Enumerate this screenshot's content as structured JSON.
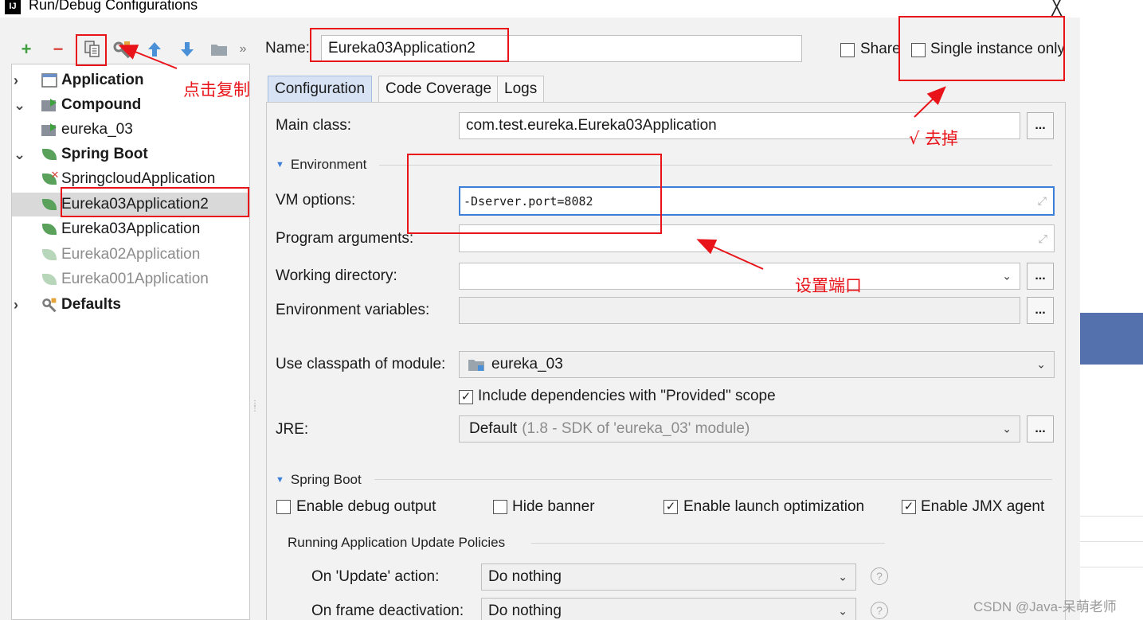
{
  "window": {
    "title": "Run/Debug Configurations",
    "app_icon_text": "IJ",
    "close_glyph": "╳"
  },
  "toolbar": {
    "add": "+",
    "remove": "−",
    "more": "»"
  },
  "tree": {
    "items": [
      {
        "label": "Application",
        "arrow": "›",
        "icon": "application-icon",
        "bold": true
      },
      {
        "label": "Compound",
        "arrow": "⌄",
        "icon": "compound-icon",
        "bold": true
      },
      {
        "label": "eureka_03",
        "icon": "compound-item-icon"
      },
      {
        "label": "Spring Boot",
        "arrow": "⌄",
        "icon": "spring-boot-icon",
        "bold": true
      },
      {
        "label": "SpringcloudApplication",
        "icon": "spring-boot-error-icon"
      },
      {
        "label": "Eureka03Application2",
        "icon": "spring-boot-run-icon",
        "selected": true
      },
      {
        "label": "Eureka03Application",
        "icon": "spring-boot-run-icon"
      },
      {
        "label": "Eureka02Application",
        "icon": "spring-boot-run-icon",
        "dimmed": true
      },
      {
        "label": "Eureka001Application",
        "icon": "spring-boot-run-icon",
        "dimmed": true
      },
      {
        "label": "Defaults",
        "arrow": "›",
        "icon": "defaults-icon",
        "bold": true
      }
    ]
  },
  "header": {
    "name_label": "Name:",
    "name_value": "Eureka03Application2",
    "share_label": "Share",
    "single_instance_label": "Single instance only"
  },
  "tabs": [
    {
      "label": "Configuration",
      "active": true
    },
    {
      "label": "Code Coverage"
    },
    {
      "label": "Logs"
    }
  ],
  "form": {
    "main_class_label": "Main class:",
    "main_class_value": "com.test.eureka.Eureka03Application",
    "ellipsis": "...",
    "environment_title": "Environment",
    "vm_options_label": "VM options:",
    "vm_options_value": "-Dserver.port=8082",
    "program_arguments_label": "Program arguments:",
    "program_arguments_value": "",
    "working_directory_label": "Working directory:",
    "working_directory_value": "",
    "environment_variables_label": "Environment variables:",
    "environment_variables_value": "",
    "classpath_label": "Use classpath of module:",
    "classpath_value": "eureka_03",
    "include_deps_label": "Include dependencies with \"Provided\" scope",
    "include_deps_checked": true,
    "jre_label": "JRE:",
    "jre_value": "Default",
    "jre_detail": "(1.8 - SDK of 'eureka_03' module)"
  },
  "spring_boot": {
    "title": "Spring Boot",
    "debug_output_label": "Enable debug output",
    "debug_output_checked": false,
    "hide_banner_label": "Hide banner",
    "hide_banner_checked": false,
    "launch_opt_label": "Enable launch optimization",
    "launch_opt_checked": true,
    "jmx_label": "Enable JMX agent",
    "jmx_checked": true,
    "policies_title": "Running Application Update Policies",
    "on_update_label": "On 'Update' action:",
    "on_update_value": "Do nothing",
    "on_frame_label": "On frame deactivation:",
    "on_frame_value": "Do nothing",
    "help_glyph": "?"
  },
  "annotations": {
    "copy_note": "点击复制",
    "uncheck_note": "√ 去掉",
    "port_note": "设置端口"
  },
  "watermark": "CSDN @Java-呆萌老师",
  "colors": {
    "annotation_red": "#e8141a",
    "accent_blue": "#3b7fd8",
    "spring_green": "#5aa15c",
    "selected_row": "#d9d9d9"
  }
}
